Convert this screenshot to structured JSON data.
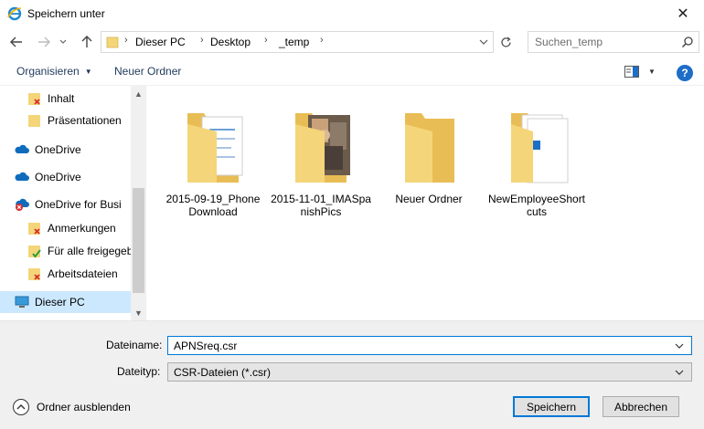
{
  "window": {
    "title": "Speichern unter",
    "close_label": "✕"
  },
  "address": {
    "crumbs": [
      "Dieser PC",
      "Desktop",
      "_temp"
    ],
    "search_placeholder": "Suchen_temp"
  },
  "toolbar": {
    "organize_label": "Organisieren",
    "new_folder_label": "Neuer Ordner",
    "help_label": "?"
  },
  "nav": {
    "items": [
      {
        "label": "Inhalt",
        "icon": "folder-error-icon"
      },
      {
        "label": "Präsentationen",
        "icon": "folder-icon"
      },
      {
        "label": "OneDrive",
        "icon": "cloud-icon"
      },
      {
        "label": "OneDrive",
        "icon": "cloud-icon"
      },
      {
        "label": "OneDrive for Busi",
        "icon": "cloud-error-icon"
      },
      {
        "label": "Anmerkungen",
        "icon": "folder-error-icon"
      },
      {
        "label": "Für alle freigegeb",
        "icon": "folder-check-icon"
      },
      {
        "label": "Arbeitsdateien",
        "icon": "folder-error-icon"
      },
      {
        "label": "Dieser PC",
        "icon": "computer-icon",
        "selected": true
      }
    ]
  },
  "files": [
    {
      "label": "2015-09-19_Phone Download",
      "kind": "documents"
    },
    {
      "label": "2015-11-01_IMASpanishPics",
      "kind": "photos"
    },
    {
      "label": "Neuer Ordner",
      "kind": "empty"
    },
    {
      "label": "NewEmployeeShortcuts",
      "kind": "shortcuts"
    }
  ],
  "form": {
    "filename_label": "Dateiname:",
    "filename_value": "APNSreq.csr",
    "filetype_label": "Dateityp:",
    "filetype_value": "CSR-Dateien (*.csr)",
    "hide_folders_label": "Ordner ausblenden",
    "save_label": "Speichern",
    "cancel_label": "Abbrechen"
  },
  "colors": {
    "accent": "#0078d7",
    "folder": "#f5d57a",
    "selected_bg": "#cce8ff",
    "help": "#1e6ec8"
  }
}
